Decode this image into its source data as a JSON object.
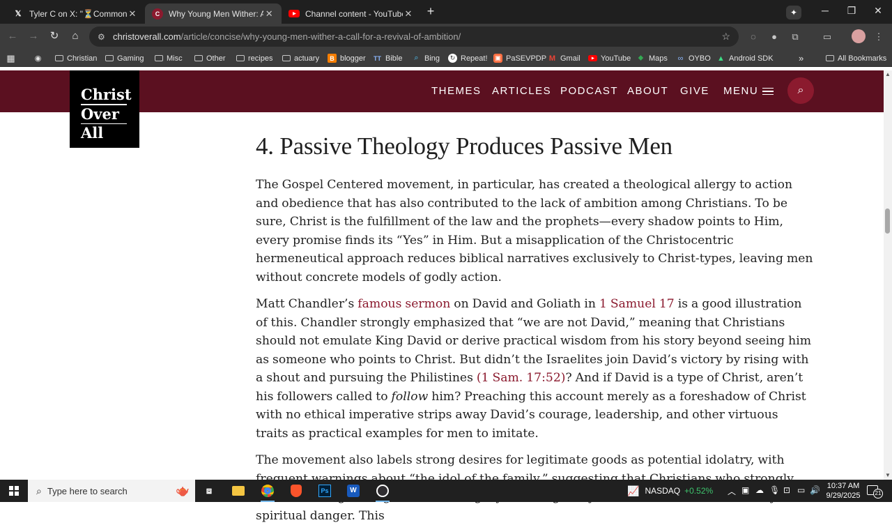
{
  "browser": {
    "tabs": [
      {
        "title": "Tyler C on X: \"⏳Common Reas",
        "favicon": "x-logo-icon",
        "active": false
      },
      {
        "title": "Why Young Men Wither: A Call",
        "favicon": "christ-over-all-icon",
        "active": true
      },
      {
        "title": "Channel content - YouTube Stu",
        "favicon": "youtube-icon",
        "active": false
      }
    ],
    "url_host": "christoverall.com",
    "url_path": "/article/concise/why-young-men-wither-a-call-for-a-revival-of-ambition/",
    "bookmarks": [
      {
        "label": "Christian",
        "icon": "folder-icon"
      },
      {
        "label": "Gaming",
        "icon": "folder-icon"
      },
      {
        "label": "Misc",
        "icon": "folder-icon"
      },
      {
        "label": "Other",
        "icon": "folder-icon"
      },
      {
        "label": "recipes",
        "icon": "folder-icon"
      },
      {
        "label": "actuary",
        "icon": "folder-icon"
      },
      {
        "label": "blogger",
        "icon": "blogger-icon"
      },
      {
        "label": "Bible",
        "icon": "bible-icon"
      },
      {
        "label": "Bing",
        "icon": "bing-icon"
      },
      {
        "label": "Repeat!",
        "icon": "repeat-icon"
      },
      {
        "label": "PaSEVPDP",
        "icon": "pasevpdp-icon"
      },
      {
        "label": "Gmail",
        "icon": "gmail-icon"
      },
      {
        "label": "YouTube",
        "icon": "youtube-icon"
      },
      {
        "label": "Maps",
        "icon": "maps-icon"
      },
      {
        "label": "OYBO",
        "icon": "oybo-icon"
      },
      {
        "label": "Android SDK",
        "icon": "android-icon"
      }
    ],
    "all_bookmarks_label": "All Bookmarks"
  },
  "site": {
    "logo_lines": [
      "Christ",
      "Over",
      "All"
    ],
    "nav": [
      "THEMES",
      "ARTICLES",
      "PODCAST",
      "ABOUT",
      "GIVE",
      "MENU"
    ],
    "accent_color": "#5b1020"
  },
  "article": {
    "heading": "4. Passive Theology Produces Passive Men",
    "p1": "The Gospel Centered movement, in particular, has created a theological allergy to action and obedience that has also contributed to the lack of ambition among Christians. To be sure, Christ is the fulfillment of the law and the prophets—every shadow points to Him, every promise finds its “Yes” in Him. But a misapplication of the Christocentric hermeneutical approach reduces biblical narratives exclusively to Christ-types, leaving men without concrete models of godly action.",
    "p2": {
      "t1": "Matt Chandler’s ",
      "link1": "famous sermon",
      "t2": " on David and Goliath in ",
      "link2": "1 Samuel 17",
      "t3": " is a good illustration of this. Chandler strongly emphasized that “we are not David,” meaning that Christians should not emulate King David or derive practical wisdom from his story beyond seeing him as someone who points to Christ. But didn’t the Israelites join David’s victory by rising with a shout and pursuing the Philistines ",
      "link3": "(1 Sam. 17:52)",
      "t4": "? And if David is a type of Christ, aren’t his followers called to ",
      "em": "follow",
      "t5": " him? Preaching this account merely as a foreshadow of Christ with no ethical imperative strips away David’s courage, leadership, and other virtuous traits as practical examples for men to imitate."
    },
    "p3": "The movement also labels strong desires for legitimate goods as potential idolatry, with frequent warnings about “the idol of the family,” suggesting that Christians who strongly desire marriage or a generational legacy must regularly evaluate themselves lest they be in spiritual danger. This"
  },
  "taskbar": {
    "search_placeholder": "Type here to search",
    "ticker_name": "NASDAQ",
    "ticker_change": "+0.52%",
    "time": "10:37 AM",
    "date": "9/29/2025",
    "notification_count": "21"
  }
}
